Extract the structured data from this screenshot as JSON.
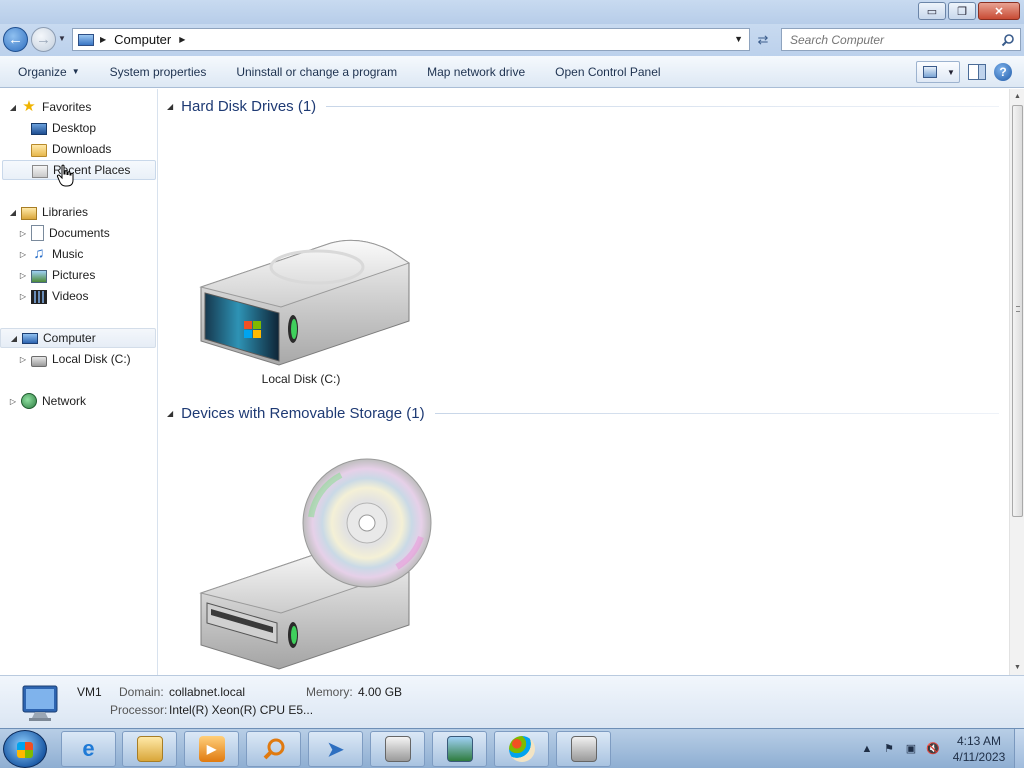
{
  "address": {
    "path": "Computer",
    "search_placeholder": "Search Computer"
  },
  "toolbar": {
    "organize": "Organize",
    "system_properties": "System properties",
    "uninstall": "Uninstall or change a program",
    "map_network_drive": "Map network drive",
    "open_control_panel": "Open Control Panel"
  },
  "window_buttons": {
    "minimize": "▭",
    "maximize": "❐",
    "close": "✕"
  },
  "sidebar": {
    "favorites": "Favorites",
    "desktop": "Desktop",
    "downloads": "Downloads",
    "recent_places": "Recent Places",
    "libraries": "Libraries",
    "documents": "Documents",
    "music": "Music",
    "pictures": "Pictures",
    "videos": "Videos",
    "computer": "Computer",
    "local_disk": "Local Disk (C:)",
    "network": "Network"
  },
  "content": {
    "groups": [
      {
        "title": "Hard Disk Drives (1)",
        "items": [
          {
            "label": "Local Disk (C:)",
            "icon": "hard-disk-icon"
          }
        ]
      },
      {
        "title": "Devices with Removable Storage (1)",
        "items": [
          {
            "label": "",
            "icon": "dvd-drive-icon"
          }
        ]
      }
    ]
  },
  "details": {
    "name": "VM1",
    "domain_label": "Domain:",
    "domain": "collabnet.local",
    "memory_label": "Memory:",
    "memory": "4.00 GB",
    "processor_label": "Processor:",
    "processor": "Intel(R) Xeon(R) CPU E5..."
  },
  "taskbar": {
    "pinned": [
      "internet-explorer-icon",
      "windows-explorer-icon",
      "media-player-icon",
      "search-icon",
      "paper-plane-icon",
      "printer-icon",
      "photo-viewer-icon",
      "paint-icon",
      "app-installer-icon"
    ],
    "clock_time": "4:13 AM",
    "clock_date": "4/11/2023"
  },
  "colors": {
    "accent": "#1e3a74",
    "chrome": "#bcd1ec",
    "taskbar": "#8eaed2"
  }
}
